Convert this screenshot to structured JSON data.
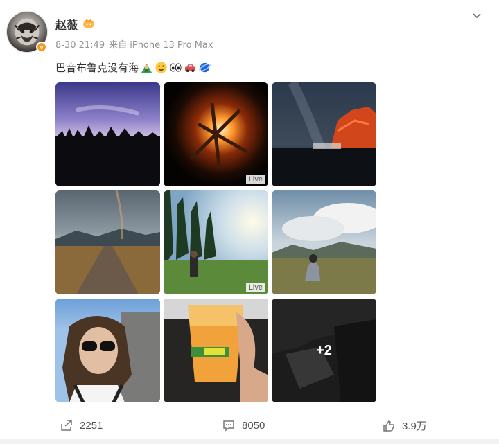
{
  "post": {
    "author": "赵薇",
    "timestamp": "8-30 21:49",
    "source": "来自 iPhone 13 Pro Max",
    "text": "巴音布鲁克没有海",
    "emojis": [
      "person-mountain-emoji",
      "smile-emoji",
      "eyes-emoji",
      "car-emoji",
      "planet-emoji"
    ]
  },
  "photos": [
    {
      "name": "silhouette-riders",
      "live": false
    },
    {
      "name": "campfire",
      "live": true,
      "live_label": "Live"
    },
    {
      "name": "starry-sky-rock",
      "live": false
    },
    {
      "name": "road-rainbow",
      "live": false
    },
    {
      "name": "forest-person",
      "live": true,
      "live_label": "Live"
    },
    {
      "name": "grassland-sitting",
      "live": false
    },
    {
      "name": "selfie-sunglasses",
      "live": false
    },
    {
      "name": "beer-cup",
      "live": false
    },
    {
      "name": "car-seat",
      "live": false,
      "more_label": "+2"
    }
  ],
  "actions": {
    "repost_count": "2251",
    "comment_count": "8050",
    "like_count": "3.9万"
  },
  "colors": {
    "meta_gray": "#939393",
    "badge_orange": "#f59a23"
  }
}
